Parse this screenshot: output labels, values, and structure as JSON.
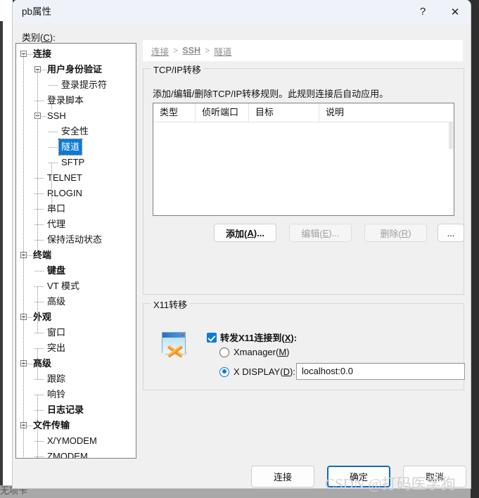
{
  "window": {
    "title": "pb属性",
    "help_icon": "?",
    "close_icon": "✕"
  },
  "category": {
    "label_pre": "类别(",
    "label_key": "C",
    "label_post": "):"
  },
  "tree": {
    "nodes": [
      {
        "label": "连接",
        "depth": 0,
        "bold": true,
        "expander": true,
        "selected": false
      },
      {
        "label": "用户身份验证",
        "depth": 1,
        "bold": true,
        "expander": true,
        "selected": false
      },
      {
        "label": "登录提示符",
        "depth": 2,
        "bold": false,
        "expander": false,
        "selected": false
      },
      {
        "label": "登录脚本",
        "depth": 1,
        "bold": false,
        "expander": false,
        "selected": false
      },
      {
        "label": "SSH",
        "depth": 1,
        "bold": false,
        "expander": true,
        "selected": false
      },
      {
        "label": "安全性",
        "depth": 2,
        "bold": false,
        "expander": false,
        "selected": false
      },
      {
        "label": "隧道",
        "depth": 2,
        "bold": false,
        "expander": false,
        "selected": true
      },
      {
        "label": "SFTP",
        "depth": 2,
        "bold": false,
        "expander": false,
        "selected": false
      },
      {
        "label": "TELNET",
        "depth": 1,
        "bold": false,
        "expander": false,
        "selected": false
      },
      {
        "label": "RLOGIN",
        "depth": 1,
        "bold": false,
        "expander": false,
        "selected": false
      },
      {
        "label": "串口",
        "depth": 1,
        "bold": false,
        "expander": false,
        "selected": false
      },
      {
        "label": "代理",
        "depth": 1,
        "bold": false,
        "expander": false,
        "selected": false
      },
      {
        "label": "保持活动状态",
        "depth": 1,
        "bold": false,
        "expander": false,
        "selected": false
      },
      {
        "label": "终端",
        "depth": 0,
        "bold": true,
        "expander": true,
        "selected": false
      },
      {
        "label": "键盘",
        "depth": 1,
        "bold": true,
        "expander": false,
        "selected": false
      },
      {
        "label": "VT 模式",
        "depth": 1,
        "bold": false,
        "expander": false,
        "selected": false
      },
      {
        "label": "高级",
        "depth": 1,
        "bold": false,
        "expander": false,
        "selected": false
      },
      {
        "label": "外观",
        "depth": 0,
        "bold": true,
        "expander": true,
        "selected": false
      },
      {
        "label": "窗口",
        "depth": 1,
        "bold": false,
        "expander": false,
        "selected": false
      },
      {
        "label": "突出",
        "depth": 1,
        "bold": false,
        "expander": false,
        "selected": false
      },
      {
        "label": "高级",
        "depth": 0,
        "bold": true,
        "expander": true,
        "selected": false
      },
      {
        "label": "跟踪",
        "depth": 1,
        "bold": false,
        "expander": false,
        "selected": false
      },
      {
        "label": "响铃",
        "depth": 1,
        "bold": false,
        "expander": false,
        "selected": false
      },
      {
        "label": "日志记录",
        "depth": 1,
        "bold": true,
        "expander": false,
        "selected": false
      },
      {
        "label": "文件传输",
        "depth": 0,
        "bold": true,
        "expander": true,
        "selected": false
      },
      {
        "label": "X/YMODEM",
        "depth": 1,
        "bold": false,
        "expander": false,
        "selected": false
      },
      {
        "label": "ZMODEM",
        "depth": 1,
        "bold": false,
        "expander": false,
        "selected": false
      }
    ]
  },
  "breadcrumb": {
    "items": [
      "连接",
      "SSH",
      "隧道"
    ],
    "separator": ">"
  },
  "tcpip": {
    "group_title": "TCP/IP转移",
    "description": "添加/编辑/删除TCP/IP转移规则。此规则连接后自动应用。",
    "columns": [
      "类型",
      "侦听端口",
      "目标",
      "说明"
    ],
    "rows": [],
    "buttons": {
      "add": {
        "pre": "添加(",
        "key": "A",
        "post": ")...",
        "enabled": true
      },
      "edit": {
        "pre": "编辑(",
        "key": "E",
        "post": ")...",
        "enabled": false
      },
      "delete": {
        "pre": "删除(",
        "key": "R",
        "post": ")",
        "enabled": false
      },
      "more": {
        "label": "...",
        "enabled": true
      }
    }
  },
  "x11": {
    "group_title": "X11转移",
    "icon": "x11-forward-icon",
    "checkbox": {
      "pre": "转发X11连接到(",
      "key": "X",
      "post": "):",
      "checked": true
    },
    "radios": [
      {
        "pre": "Xmanager(",
        "key": "M",
        "post": ")",
        "selected": false
      },
      {
        "pre": "X DISPLAY(",
        "key": "D",
        "post": "):",
        "selected": true
      }
    ],
    "display_input": {
      "value": "localhost:0.0",
      "placeholder": ""
    }
  },
  "footer": {
    "connect": "连接",
    "ok": "确定",
    "cancel": "取消"
  },
  "watermark": "CSDN @打码医学狗",
  "background": {
    "taskbar_text": "无项卡"
  },
  "colors": {
    "accent": "#0a7bd6",
    "dialog_bg": "#f0f0f0",
    "titlebar_bg": "#eff3f9",
    "selection": "#0a7bd6",
    "disabled_text": "#a0a0a0"
  }
}
